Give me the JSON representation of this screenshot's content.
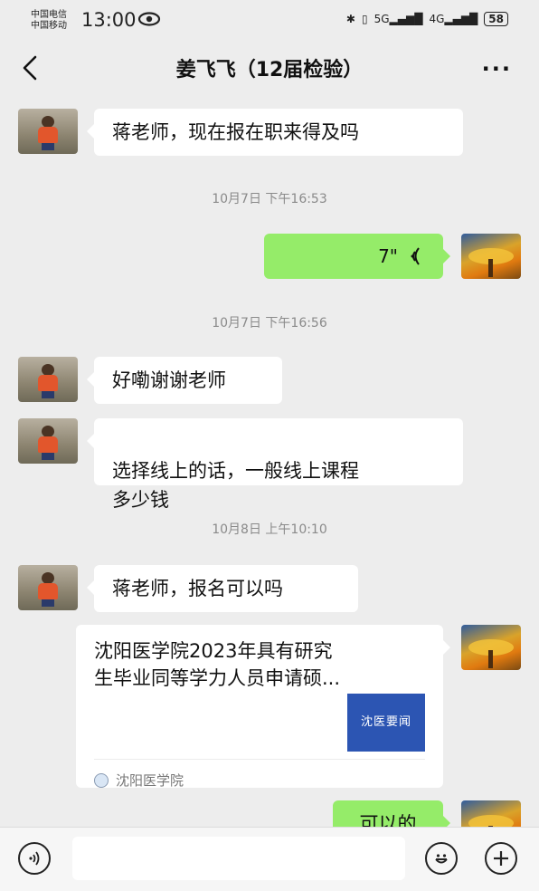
{
  "status_bar": {
    "carrier_1": "中国电信",
    "carrier_2": "中国移动",
    "time": "13:00",
    "network_5g": "5G",
    "network_4g": "4G",
    "battery": "58"
  },
  "header": {
    "title": "姜飞飞（12届检验）"
  },
  "messages": [
    {
      "type": "text",
      "side": "left",
      "text": "蒋老师，现在报在职来得及吗"
    },
    {
      "type": "time",
      "text": "10月7日 下午16:53"
    },
    {
      "type": "voice",
      "side": "right",
      "duration": "7\""
    },
    {
      "type": "time",
      "text": "10月7日 下午16:56"
    },
    {
      "type": "text",
      "side": "left",
      "text": "好嘞谢谢老师"
    },
    {
      "type": "text",
      "side": "left",
      "text": "选择线上的话，一般线上课程\n多少钱"
    },
    {
      "type": "time",
      "text": "10月8日 上午10:10"
    },
    {
      "type": "text",
      "side": "left",
      "text": "蒋老师，报名可以吗"
    },
    {
      "type": "link",
      "side": "right",
      "title": "沈阳医学院2023年具有研究\n生毕业同等学力人员申请硕...",
      "thumb_text": "沈医要闻",
      "source": "沈阳医学院"
    },
    {
      "type": "text",
      "side": "right",
      "text": "可以的"
    }
  ],
  "colors": {
    "background": "#ededed",
    "outgoing_bubble": "#95ec69",
    "incoming_bubble": "#ffffff",
    "link_thumb": "#2c55b3"
  },
  "icons": {
    "back": "chevron-left-icon",
    "more": "more-dots-icon",
    "voice_input": "voice-mode-icon",
    "emoji": "emoji-icon",
    "plus": "plus-icon"
  }
}
